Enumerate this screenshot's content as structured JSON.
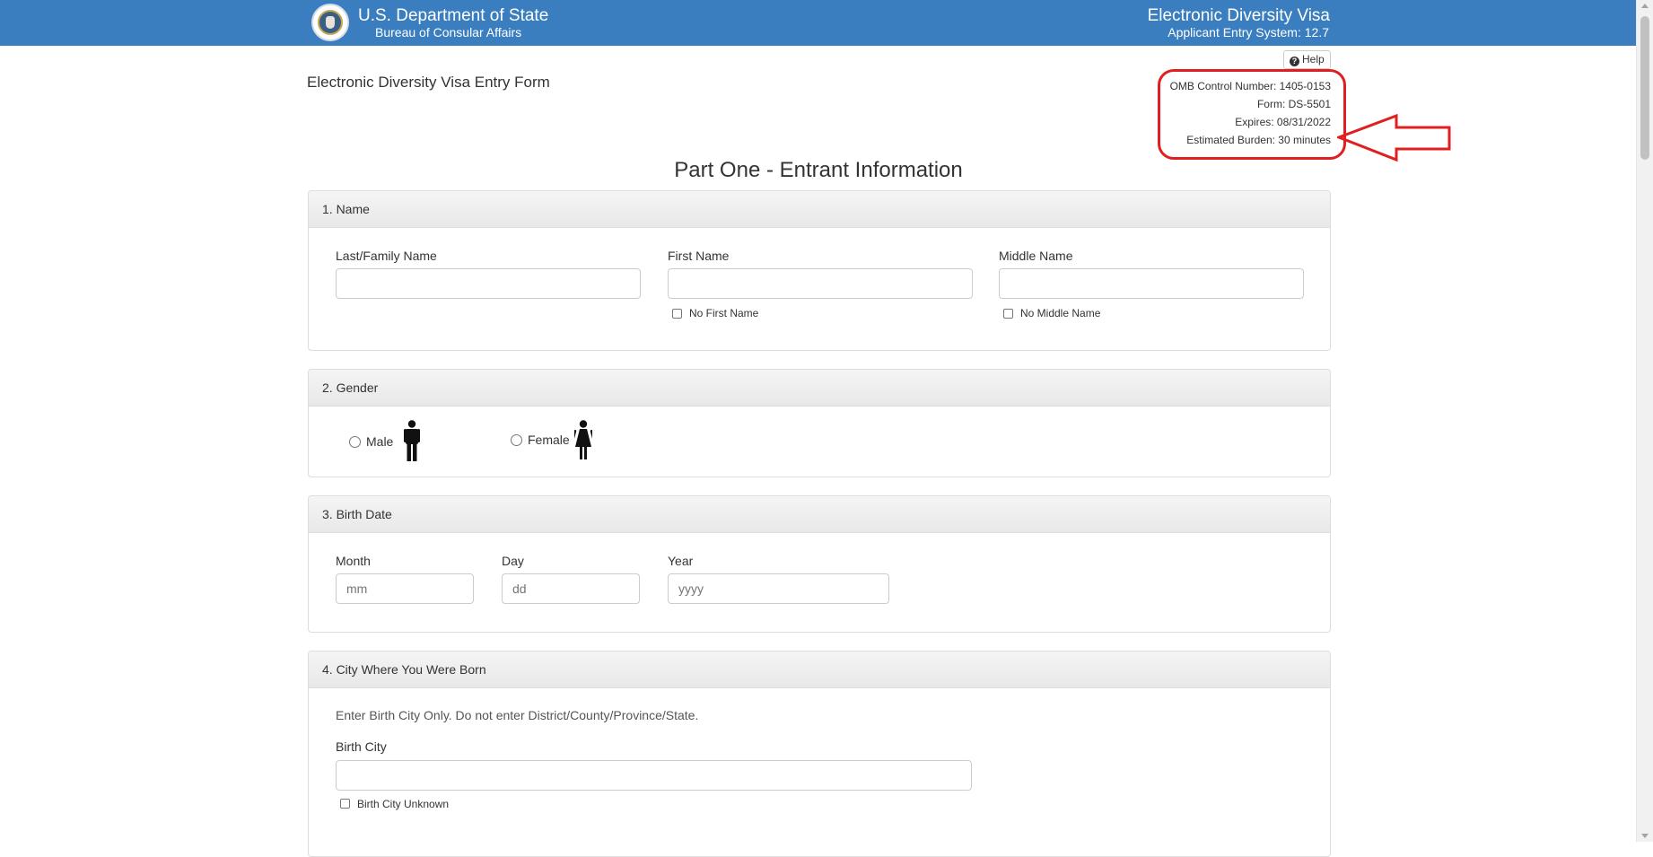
{
  "header": {
    "department": "U.S. Department of State",
    "bureau": "Bureau of Consular Affairs",
    "app_title": "Electronic Diversity Visa",
    "app_subtitle": "Applicant Entry System: 12.7"
  },
  "page": {
    "form_title": "Electronic Diversity Visa Entry Form",
    "help_label": "Help",
    "part_title": "Part One - Entrant Information"
  },
  "omb": {
    "control_number": "OMB Control Number: 1405-0153",
    "form": "Form: DS-5501",
    "expires": "Expires: 08/31/2022",
    "burden": "Estimated Burden: 30 minutes"
  },
  "annotation": {
    "color": "#e02020"
  },
  "sections": {
    "name": {
      "title": "1. Name",
      "last_label": "Last/Family Name",
      "last_value": "",
      "first_label": "First Name",
      "first_value": "",
      "middle_label": "Middle Name",
      "middle_value": "",
      "no_first": "No First Name",
      "no_middle": "No Middle Name"
    },
    "gender": {
      "title": "2. Gender",
      "male": "Male",
      "female": "Female",
      "male_icon": "male-figure-icon",
      "female_icon": "female-figure-icon"
    },
    "birth_date": {
      "title": "3. Birth Date",
      "month_label": "Month",
      "month_placeholder": "mm",
      "day_label": "Day",
      "day_placeholder": "dd",
      "year_label": "Year",
      "year_placeholder": "yyyy"
    },
    "birth_city": {
      "title": "4. City Where You Were Born",
      "instructions": "Enter Birth City Only. Do not enter District/County/Province/State.",
      "city_label": "Birth City",
      "city_value": "",
      "unknown_label": "Birth City Unknown"
    }
  },
  "colors": {
    "header_bg": "#3a7ebf",
    "panel_border": "#dddddd",
    "annotation": "#e02020"
  }
}
